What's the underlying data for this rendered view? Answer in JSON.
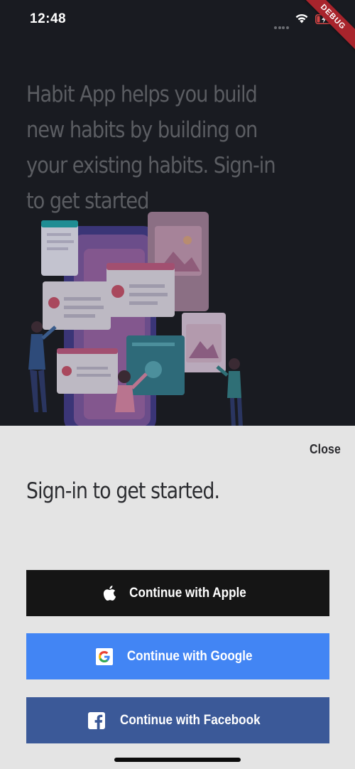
{
  "status_bar": {
    "time": "12:48",
    "debug_label": "DEBUG"
  },
  "intro": {
    "text": "Habit App helps you build new habits by building on your existing habits. Sign-in to get started"
  },
  "sheet": {
    "close_label": "Close",
    "title": "Sign-in to get started.",
    "buttons": {
      "apple": "Continue with Apple",
      "google": "Continue with Google",
      "facebook": "Continue with Facebook"
    }
  },
  "colors": {
    "background": "#191b21",
    "sheet": "#e4e4e4",
    "apple": "#151515",
    "google": "#4285f4",
    "facebook": "#3b5998",
    "debug_ribbon": "#a8242c"
  },
  "icons": [
    "wifi-icon",
    "battery-charging-icon",
    "apple-icon",
    "google-icon",
    "facebook-icon"
  ]
}
